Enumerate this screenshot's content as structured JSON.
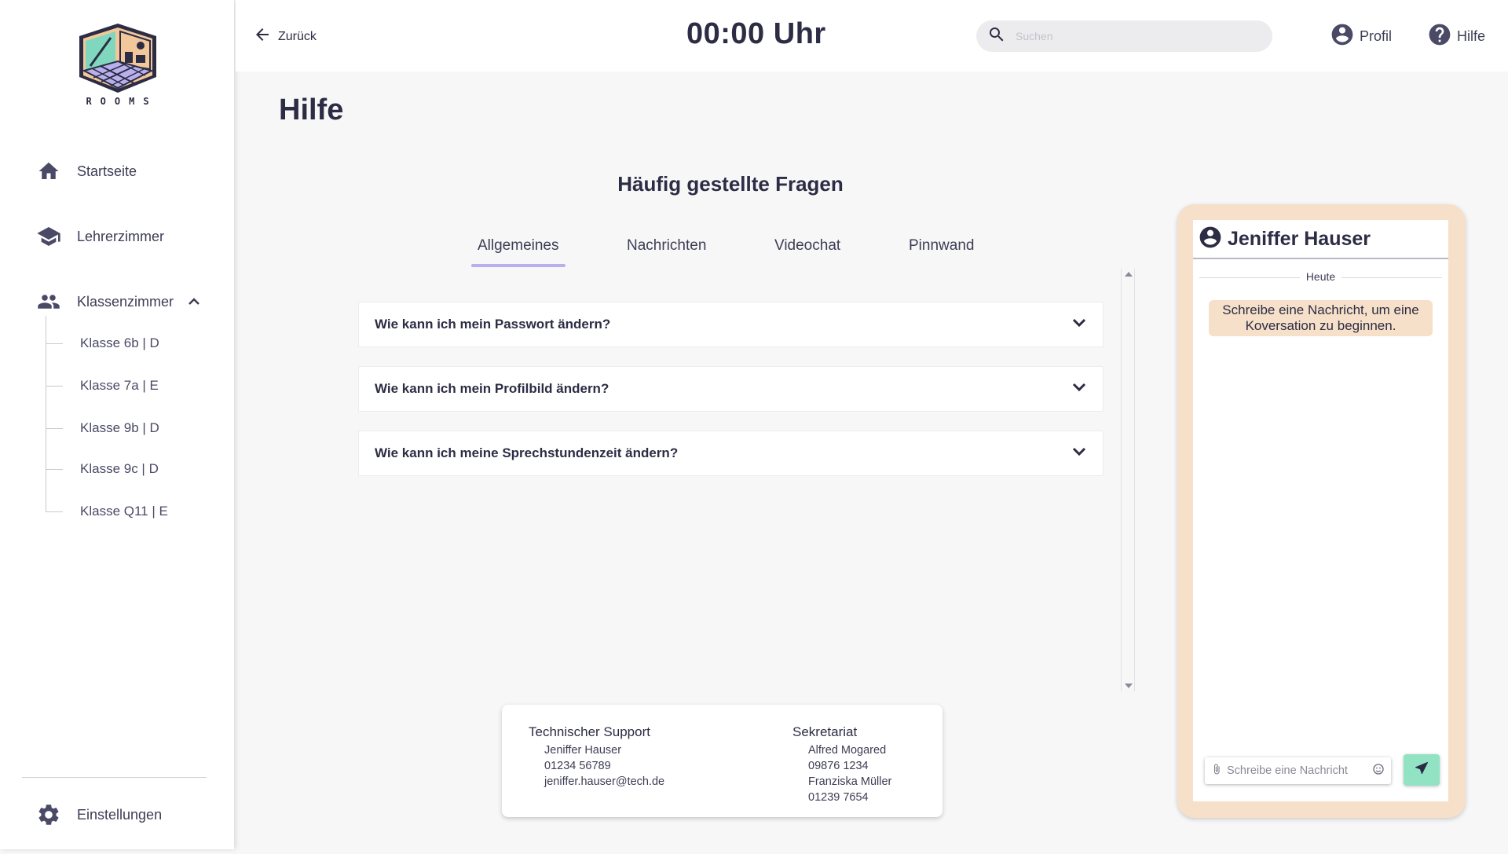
{
  "app": {
    "logo_text": "ROOMS"
  },
  "sidebar": {
    "items": [
      {
        "label": "Startseite",
        "icon": "home-icon"
      },
      {
        "label": "Lehrerzimmer",
        "icon": "graduation-cap-icon"
      },
      {
        "label": "Klassenzimmer",
        "icon": "people-icon",
        "expanded": true
      }
    ],
    "classes": [
      "Klasse 6b | D",
      "Klasse 7a | E",
      "Klasse 9b | D",
      "Klasse 9c | D",
      "Klasse Q11 | E"
    ],
    "settings_label": "Einstellungen"
  },
  "topbar": {
    "back_label": "Zurück",
    "clock": "00:00 Uhr",
    "search_placeholder": "Suchen",
    "profile_label": "Profil",
    "help_label": "Hilfe"
  },
  "main": {
    "page_title": "Hilfe",
    "faq_title": "Häufig gestellte Fragen",
    "tabs": [
      {
        "label": "Allgemeines",
        "active": true
      },
      {
        "label": "Nachrichten",
        "active": false
      },
      {
        "label": "Videochat",
        "active": false
      },
      {
        "label": "Pinnwand",
        "active": false
      }
    ],
    "faq_items": [
      "Wie kann ich mein Passwort ändern?",
      "Wie kann ich mein Profilbild ändern?",
      "Wie kann ich meine Sprechstundenzeit ändern?"
    ]
  },
  "contacts": {
    "tech": {
      "heading": "Technischer Support",
      "lines": [
        "Jeniffer Hauser",
        "01234 56789",
        "jeniffer.hauser@tech.de"
      ]
    },
    "office": {
      "heading": "Sekretariat",
      "lines": [
        "Alfred Mogared",
        "09876 1234",
        "Franziska Müller",
        "01239 7654"
      ]
    }
  },
  "chat": {
    "contact_name": "Jeniffer Hauser",
    "day_label": "Heute",
    "hint": "Schreibe eine Nachricht, um eine Koversation zu beginnen.",
    "input_placeholder": "Schreibe eine Nachricht"
  },
  "colors": {
    "accent_tab": "#b7b0ec",
    "chat_frame": "#f6e0c9",
    "send_button": "#92e2c4",
    "text_dark": "#2c2c44"
  }
}
